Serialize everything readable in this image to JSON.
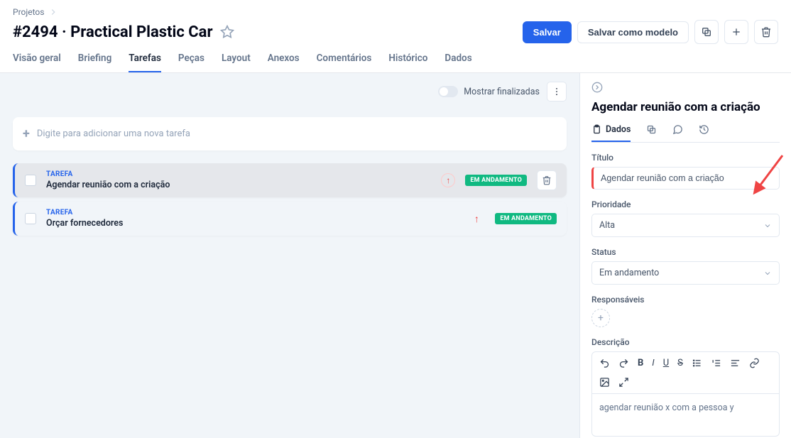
{
  "breadcrumb": {
    "root": "Projetos"
  },
  "page_title": "#2494 · Practical Plastic Car",
  "actions": {
    "save": "Salvar",
    "save_as_model": "Salvar como modelo"
  },
  "tabs": [
    "Visão geral",
    "Briefing",
    "Tarefas",
    "Peças",
    "Layout",
    "Anexos",
    "Comentários",
    "Histórico",
    "Dados"
  ],
  "active_tab_index": 2,
  "task_list": {
    "show_finished_label": "Mostrar finalizadas",
    "add_placeholder": "Digite para adicionar uma nova tarefa",
    "task_type_label": "TAREFA",
    "items": [
      {
        "title": "Agendar reunião com a criação",
        "status": "EM ANDAMENTO",
        "selected": true
      },
      {
        "title": "Orçar fornecedores",
        "status": "EM ANDAMENTO",
        "selected": false
      }
    ]
  },
  "side_panel": {
    "title": "Agendar reunião com a criação",
    "tabs": {
      "dados": "Dados"
    },
    "fields": {
      "titulo_label": "Título",
      "titulo_value": "Agendar reunião com a criação",
      "prioridade_label": "Prioridade",
      "prioridade_value": "Alta",
      "status_label": "Status",
      "status_value": "Em andamento",
      "responsaveis_label": "Responsáveis",
      "descricao_label": "Descrição",
      "descricao_value": "agendar reunião x com a pessoa y"
    }
  }
}
